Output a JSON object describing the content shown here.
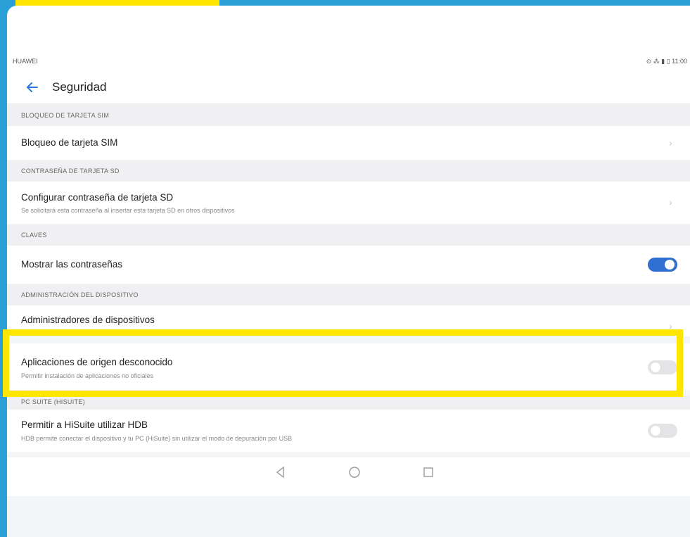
{
  "colors": {
    "accent": "#2f6fd0",
    "highlight": "#ffe600",
    "frame": "#2a9fd8"
  },
  "status": {
    "left": "HUAWEI",
    "right": "⊙ ⁂ ▮ ▯ 11:00"
  },
  "header": {
    "title": "Seguridad",
    "back_icon": "back-arrow-icon"
  },
  "sections": {
    "sim": {
      "header": "BLOQUEO DE TARJETA SIM",
      "item_title": "Bloqueo de tarjeta SIM"
    },
    "sd": {
      "header": "CONTRASEÑA DE TARJETA SD",
      "item_title": "Configurar contraseña de tarjeta SD",
      "item_sub": "Se solicitará esta contraseña al insertar esta tarjeta SD en otros dispositivos"
    },
    "keys": {
      "header": "CLAVES",
      "item_title": "Mostrar las contraseñas",
      "toggle": "on"
    },
    "admin": {
      "header": "ADMINISTRACIÓN DEL DISPOSITIVO",
      "item_title": "Administradores de dispositivos"
    },
    "unknown": {
      "item_title": "Aplicaciones de origen desconocido",
      "item_sub": "Permitir instalación de aplicaciones no oficiales",
      "toggle": "off"
    },
    "hisuite": {
      "header": "PC SUITE (HISUITE)",
      "item_title": "Permitir a HiSuite utilizar HDB",
      "item_sub": "HDB permite conectar el dispositivo y tu PC (HiSuite) sin utilizar el modo de depuración por USB",
      "toggle": "off"
    }
  },
  "nav": {
    "back": "back-triangle-icon",
    "home": "home-circle-icon",
    "recents": "recents-square-icon"
  }
}
